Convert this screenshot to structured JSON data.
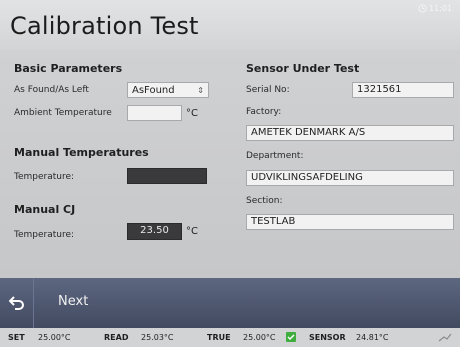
{
  "window": {
    "title": "Calibration Test",
    "clock": "11:01"
  },
  "basic": {
    "title": "Basic Parameters",
    "as_found_label": "As Found/As Left",
    "as_found_value": "AsFound",
    "ambient_label": "Ambient Temperature",
    "ambient_value": "",
    "ambient_unit": "°C"
  },
  "manual_temp": {
    "title": "Manual Temperatures",
    "temp_label": "Temperature:",
    "temp_value": ""
  },
  "manual_cj": {
    "title": "Manual CJ",
    "temp_label": "Temperature:",
    "temp_value": "23.50",
    "temp_unit": "°C"
  },
  "sensor": {
    "title": "Sensor Under Test",
    "serial_label": "Serial No:",
    "serial_value": "1321561",
    "factory_label": "Factory:",
    "factory_value": "AMETEK DENMARK A/S",
    "department_label": "Department:",
    "department_value": "UDVIKLINGSAFDELING",
    "section_label": "Section:",
    "section_value": "TESTLAB"
  },
  "nav": {
    "next_label": "Next"
  },
  "status": {
    "set_label": "SET",
    "set_value": "25.00°C",
    "read_label": "READ",
    "read_value": "25.03°C",
    "true_label": "TRUE",
    "true_value": "25.00°C",
    "sensor_label": "SENSOR",
    "sensor_value": "24.81°C"
  },
  "icons": {
    "back": "back-arrow-icon",
    "clock": "clock-icon",
    "ok": "checkmark-icon",
    "signal": "signal-icon",
    "dropdown": "chevron-updown-icon"
  },
  "colors": {
    "background": "#cfd0d2",
    "navbar": "#4c566d",
    "dark_field": "#3a3a3c",
    "ok_green": "#3fae3f"
  }
}
